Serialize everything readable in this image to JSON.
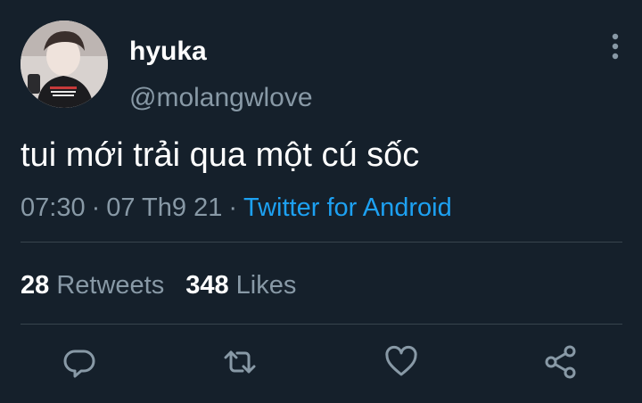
{
  "tweet": {
    "author": {
      "name": "hyuka",
      "handle": "@molangwlove",
      "avatar_icon": "profile-photo"
    },
    "text": "tui mới trải qua một cú sốc",
    "time": "07:30",
    "separator": "·",
    "date": "07 Th9 21",
    "source": "Twitter for Android",
    "stats": {
      "retweets_count": "28",
      "retweets_label": "Retweets",
      "likes_count": "348",
      "likes_label": "Likes"
    },
    "actions": [
      {
        "icon": "reply-icon"
      },
      {
        "icon": "retweet-icon"
      },
      {
        "icon": "like-icon"
      },
      {
        "icon": "share-icon"
      }
    ]
  },
  "colors": {
    "background": "#15202b",
    "primary_text": "#ffffff",
    "secondary_text": "#8899a6",
    "link": "#1da1f2",
    "divider": "#38444d"
  }
}
